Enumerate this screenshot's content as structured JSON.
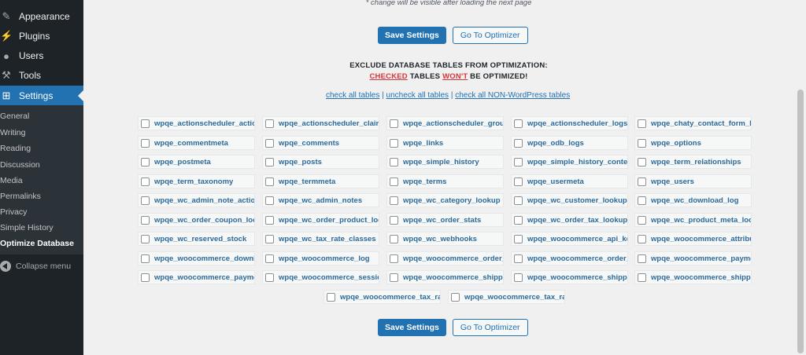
{
  "sidebar": {
    "menu": [
      {
        "label": "Appearance",
        "icon": "paintbrush-icon",
        "glyph": "✎"
      },
      {
        "label": "Plugins",
        "icon": "plug-icon",
        "glyph": "⚡"
      },
      {
        "label": "Users",
        "icon": "users-icon",
        "glyph": "👤"
      },
      {
        "label": "Tools",
        "icon": "wrench-icon",
        "glyph": "🔧"
      },
      {
        "label": "Settings",
        "icon": "settings-icon",
        "glyph": "⊞"
      }
    ],
    "submenu": [
      "General",
      "Writing",
      "Reading",
      "Discussion",
      "Media",
      "Permalinks",
      "Privacy",
      "Simple History",
      "Optimize Database"
    ],
    "collapse_label": "Collapse menu"
  },
  "note": "* change will be visible after loading the next page",
  "buttons": {
    "save": "Save Settings",
    "go": "Go To Optimizer"
  },
  "heading": {
    "line1": "EXCLUDE DATABASE TABLES FROM OPTIMIZATION:",
    "checked": "CHECKED",
    "tables": " TABLES ",
    "wont": "WON'T",
    "rest": " BE OPTIMIZED!"
  },
  "links": {
    "check_all": "check all tables",
    "uncheck_all": "uncheck all tables",
    "check_non_wp": "check all NON-WordPress tables",
    "separator": "|"
  },
  "tables": [
    "wpqe_actionscheduler_actions",
    "wpqe_actionscheduler_claims",
    "wpqe_actionscheduler_groups",
    "wpqe_actionscheduler_logs",
    "wpqe_chaty_contact_form_leads",
    "wpqe_commentmeta",
    "wpqe_comments",
    "wpqe_links",
    "wpqe_odb_logs",
    "wpqe_options",
    "wpqe_postmeta",
    "wpqe_posts",
    "wpqe_simple_history",
    "wpqe_simple_history_contexts",
    "wpqe_term_relationships",
    "wpqe_term_taxonomy",
    "wpqe_termmeta",
    "wpqe_terms",
    "wpqe_usermeta",
    "wpqe_users",
    "wpqe_wc_admin_note_actions",
    "wpqe_wc_admin_notes",
    "wpqe_wc_category_lookup",
    "wpqe_wc_customer_lookup",
    "wpqe_wc_download_log",
    "wpqe_wc_order_coupon_lookup",
    "wpqe_wc_order_product_lookup",
    "wpqe_wc_order_stats",
    "wpqe_wc_order_tax_lookup",
    "wpqe_wc_product_meta_lookup",
    "wpqe_wc_reserved_stock",
    "wpqe_wc_tax_rate_classes",
    "wpqe_wc_webhooks",
    "wpqe_woocommerce_api_keys",
    "wpqe_woocommerce_attribute_taxonomies",
    "wpqe_woocommerce_downloadable_product_permissions",
    "wpqe_woocommerce_log",
    "wpqe_woocommerce_order_itemmeta",
    "wpqe_woocommerce_order_items",
    "wpqe_woocommerce_payment_tokenmeta",
    "wpqe_woocommerce_payment_tokens",
    "wpqe_woocommerce_sessions",
    "wpqe_woocommerce_shipping_zone_locations",
    "wpqe_woocommerce_shipping_zone_methods",
    "wpqe_woocommerce_shipping_zones",
    "wpqe_woocommerce_tax_rate_locations",
    "wpqe_woocommerce_tax_rates"
  ]
}
